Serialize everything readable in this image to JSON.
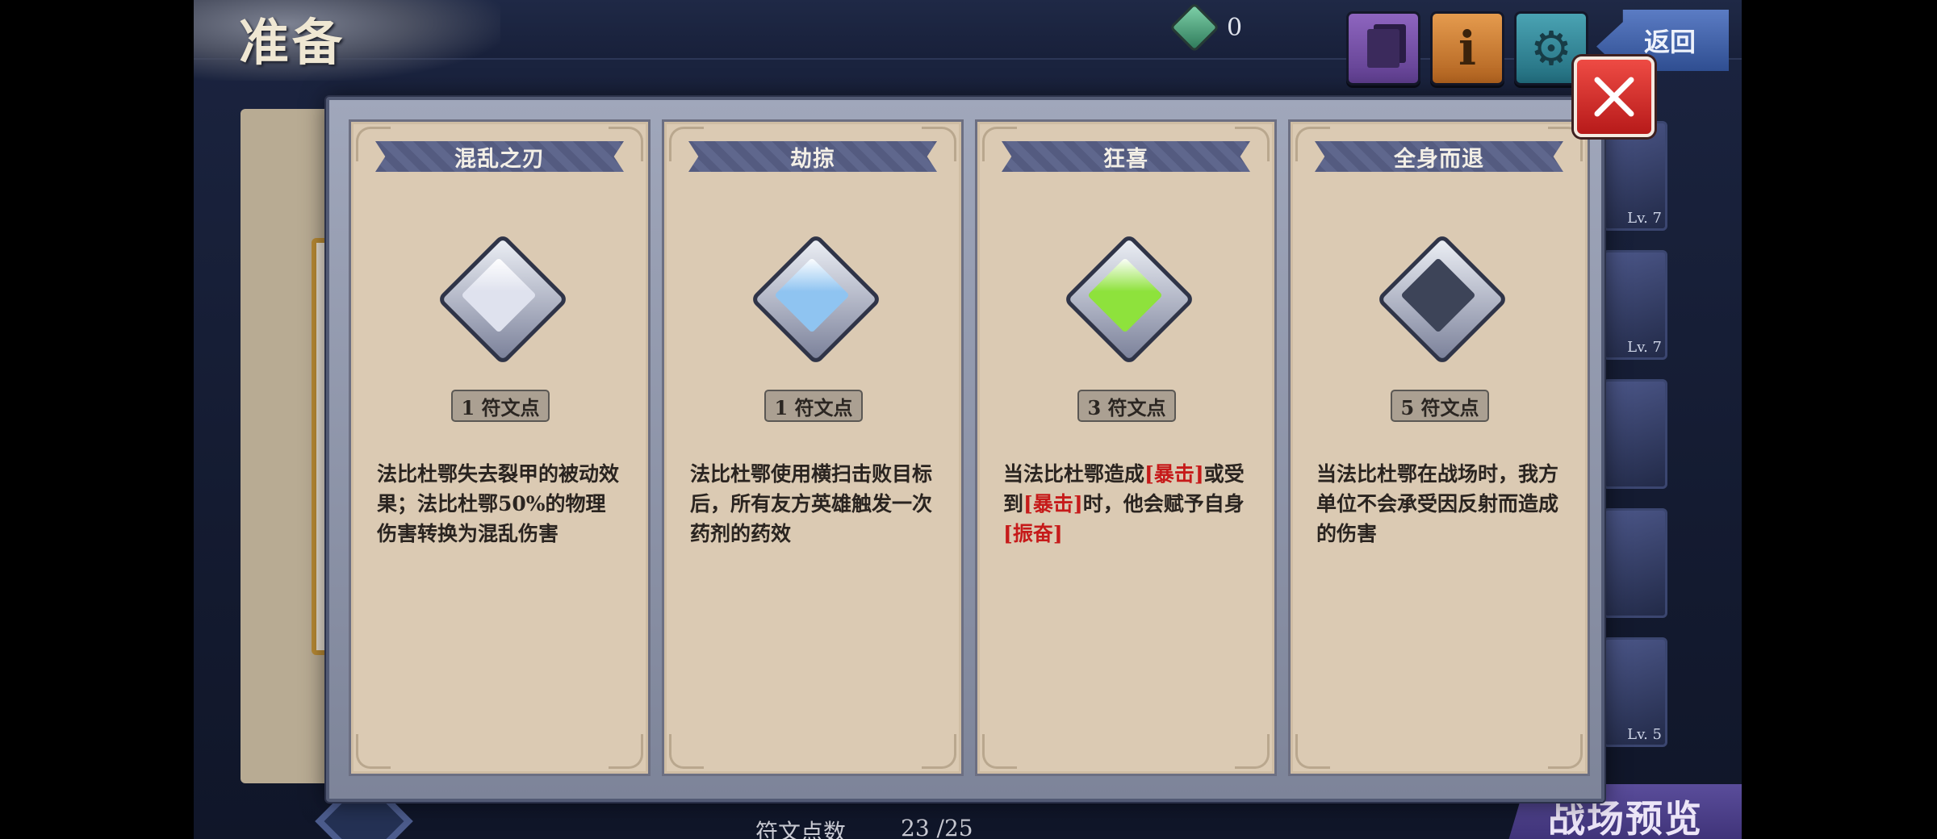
{
  "header": {
    "title": "准备",
    "currency_value": "0",
    "back_label": "返回"
  },
  "background": {
    "rune_points_label": "符文点数",
    "rune_points_value": "23 /25",
    "battle_preview_label": "战场预览",
    "hero_levels": [
      "Lv. 7",
      "Lv. 7",
      "",
      "",
      "Lv. 5"
    ]
  },
  "colors": {
    "close_button": "#d9302b",
    "highlight_text": "#c61a1a",
    "card_bg": "#dbcab3"
  },
  "cards": [
    {
      "title": "混乱之刃",
      "gem": "white-diamond-icon",
      "gem_color": "#dfe2ee",
      "cost": "1 符文点",
      "desc_parts": [
        {
          "text": "法比杜鄂失去裂甲的被动效果；法比杜鄂50%的物理伤害转换为混乱伤害",
          "hl": false
        }
      ]
    },
    {
      "title": "劫掠",
      "gem": "blue-diamond-icon",
      "gem_color": "#8fc4f1",
      "cost": "1 符文点",
      "desc_parts": [
        {
          "text": "法比杜鄂使用横扫击败目标后，所有友方英雄触发一次药剂的药效",
          "hl": false
        }
      ]
    },
    {
      "title": "狂喜",
      "gem": "green-diamond-icon",
      "gem_color": "#8ee23c",
      "cost": "3 符文点",
      "desc_parts": [
        {
          "text": "当法比杜鄂造成",
          "hl": false
        },
        {
          "text": "[暴击]",
          "hl": true
        },
        {
          "text": "或受到",
          "hl": false
        },
        {
          "text": "[暴击]",
          "hl": true
        },
        {
          "text": "时，他会赋予自身",
          "hl": false
        },
        {
          "text": "[振奋]",
          "hl": true
        }
      ]
    },
    {
      "title": "全身而退",
      "gem": "dark-diamond-icon",
      "gem_color": "#3d4458",
      "cost": "5 符文点",
      "desc_parts": [
        {
          "text": "当法比杜鄂在战场时，我方单位不会承受因反射而造成的伤害",
          "hl": false
        }
      ]
    }
  ]
}
